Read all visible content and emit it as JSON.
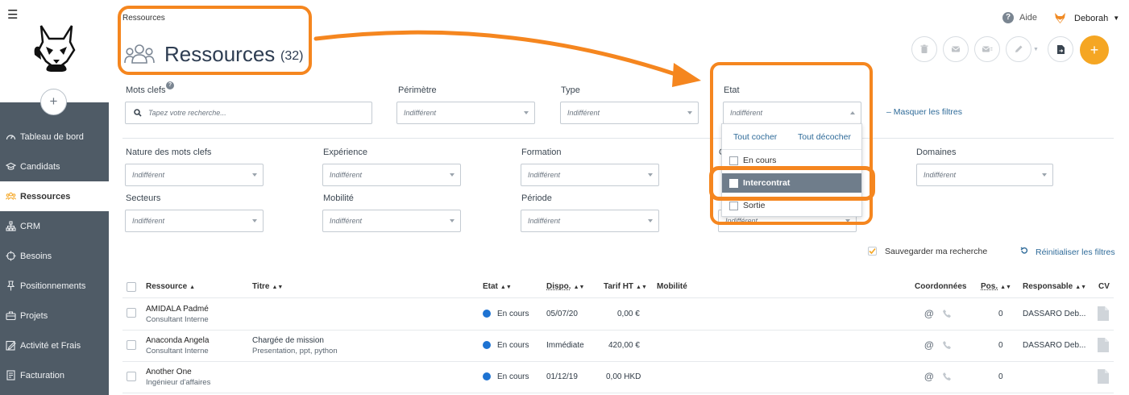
{
  "breadcrumb": "Ressources",
  "page": {
    "title": "Ressources",
    "count": "(32)"
  },
  "header": {
    "help_label": "Aide",
    "user_name": "Deborah"
  },
  "sidebar": {
    "items": [
      {
        "label": "Tableau de bord",
        "icon": "dashboard-icon"
      },
      {
        "label": "Candidats",
        "icon": "graduation-cap-icon"
      },
      {
        "label": "Ressources",
        "icon": "people-icon",
        "active": true
      },
      {
        "label": "CRM",
        "icon": "sitemap-icon"
      },
      {
        "label": "Besoins",
        "icon": "crosshair-icon"
      },
      {
        "label": "Positionnements",
        "icon": "pin-icon"
      },
      {
        "label": "Projets",
        "icon": "briefcase-icon"
      },
      {
        "label": "Activité et Frais",
        "icon": "edit-icon"
      },
      {
        "label": "Facturation",
        "icon": "invoice-icon"
      }
    ]
  },
  "filters": {
    "keywords_label": "Mots clefs",
    "search_placeholder": "Tapez votre recherche...",
    "perimetre_label": "Périmètre",
    "type_label": "Type",
    "etat_label": "Etat",
    "mask_filters": "– Masquer les filtres",
    "nature_label": "Nature des mots clefs",
    "experience_label": "Expérience",
    "formation_label": "Formation",
    "domaines_label": "Domaines",
    "secteurs_label": "Secteurs",
    "mobilite_label": "Mobilité",
    "periode_label": "Période",
    "hidden_label_c": "C",
    "default_value": "Indifférent",
    "save_search": "Sauvegarder ma recherche",
    "reset_filters": "Réinitialiser les filtres"
  },
  "etat_dropdown": {
    "check_all": "Tout cocher",
    "uncheck_all": "Tout décocher",
    "options": [
      {
        "label": "En cours",
        "highlighted": false
      },
      {
        "label": "Intercontrat",
        "highlighted": true
      },
      {
        "label": "Sortie",
        "highlighted": false
      }
    ]
  },
  "table": {
    "columns": {
      "ressource": "Ressource",
      "titre": "Titre",
      "etat": "Etat",
      "dispo": "Dispo.",
      "tarif": "Tarif HT",
      "mobilite": "Mobilité",
      "coordonnees": "Coordonnées",
      "pos": "Pos.",
      "responsable": "Responsable",
      "cv": "CV"
    },
    "rows": [
      {
        "name": "AMIDALA Padmé",
        "role": "Consultant Interne",
        "title": "",
        "title_sub": "",
        "etat": "En cours",
        "dispo": "05/07/20",
        "tarif": "0,00 €",
        "at": "@",
        "pos": "0",
        "responsable": "DASSARO Deb..."
      },
      {
        "name": "Anaconda Angela",
        "role": "Consultant Interne",
        "title": "Chargée de mission",
        "title_sub": "Presentation, ppt, python",
        "etat": "En cours",
        "dispo": "Immédiate",
        "tarif": "420,00 €",
        "at": "@",
        "pos": "0",
        "responsable": "DASSARO Deb..."
      },
      {
        "name": "Another One",
        "role": "Ingénieur d'affaires",
        "title": "",
        "title_sub": "",
        "etat": "En cours",
        "dispo": "01/12/19",
        "tarif": "0,00 HKD",
        "at": "@",
        "pos": "0",
        "responsable": ""
      }
    ]
  },
  "colors": {
    "accent": "#f5861f",
    "sidebar": "#4f5b66",
    "link": "#2f6b99",
    "status_dot": "#1e73d2"
  }
}
